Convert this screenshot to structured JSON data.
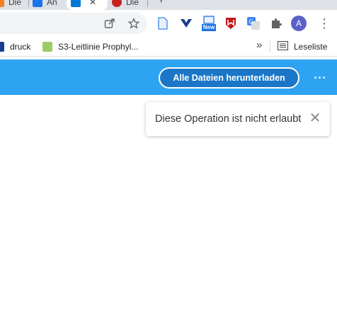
{
  "browser": {
    "tabs": [
      {
        "label": "Die",
        "favicon_color": "#f48024"
      },
      {
        "label": "An",
        "favicon_color": "#1a73e8"
      },
      {
        "label": "",
        "favicon_color": "#0078d4",
        "active": true
      },
      {
        "label": "Die",
        "favicon_color": "#c5221f"
      }
    ],
    "new_tab_symbol": "+",
    "toolbar_icons": [
      "share-icon",
      "bookmark-star-icon",
      "document-icon",
      "vpn-heart-icon",
      "new-extension-icon",
      "mcafee-icon",
      "translate-icon",
      "extensions-puzzle-icon"
    ],
    "new_badge": "New",
    "profile_initial": "A",
    "menu_symbol": "⋮",
    "bookmarks": [
      {
        "label": "druck",
        "icon_color": "#1a3d8f"
      },
      {
        "label": "S3-Leitlinie Prophyl...",
        "icon_color": "#9ccc65"
      }
    ],
    "overflow_symbol": "»",
    "reading_list_label": "Leseliste"
  },
  "app": {
    "header_color": "#2ea3f2",
    "download_all_label": "Alle Dateien herunterladen",
    "more_symbol": "⋯"
  },
  "toast": {
    "message": "Diese Operation ist nicht erlaubt",
    "close_symbol": "✕"
  }
}
